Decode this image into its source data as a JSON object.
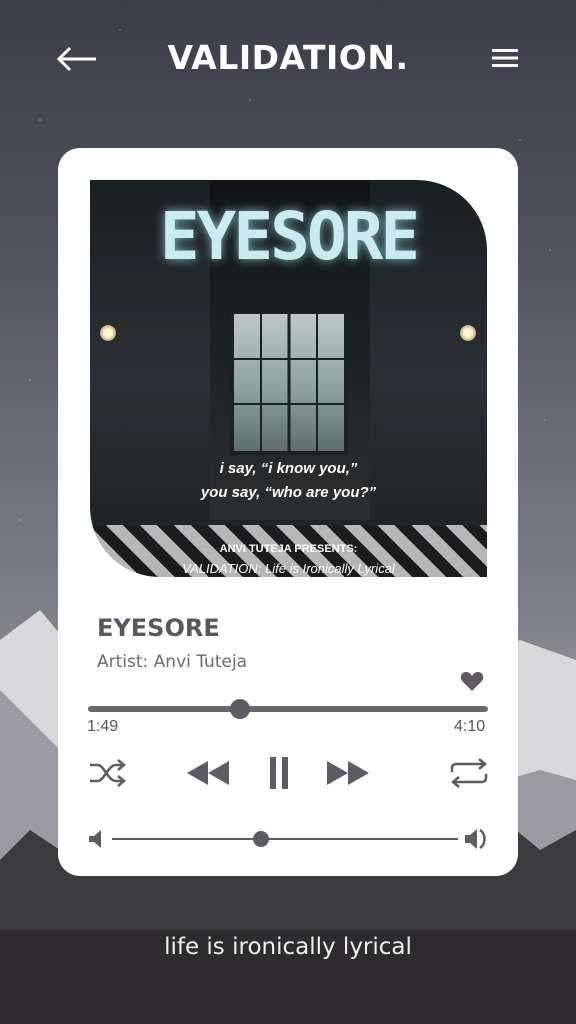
{
  "header": {
    "back_icon": "arrow-left-icon",
    "title": "VALIDATION.",
    "menu_icon": "hamburger-menu-icon"
  },
  "album_art": {
    "title": "EYESORE",
    "quote_line1": "i say, “i know you,”",
    "quote_line2": "you say, “who are you?”",
    "presents": "ANVI TUTEJA PRESENTS:",
    "album_name": "VALIDATION: Life is Ironically Lyrical"
  },
  "track": {
    "title": "EYESORE",
    "artist": "Artist: Anvi Tuteja",
    "favorite_icon": "heart-icon"
  },
  "progress": {
    "current_time": "1:49",
    "total_time": "4:10",
    "fraction": 0.38
  },
  "controls": {
    "shuffle_icon": "shuffle-icon",
    "rewind_icon": "rewind-icon",
    "pause_icon": "pause-icon",
    "forward_icon": "fast-forward-icon",
    "repeat_icon": "repeat-icon"
  },
  "volume": {
    "low_icon": "volume-low-icon",
    "high_icon": "volume-high-icon",
    "fraction": 0.43
  },
  "tagline": "life is ironically lyrical",
  "colors": {
    "card": "#ffffff",
    "accent": "#5f5b66",
    "text_dark": "#595761"
  }
}
